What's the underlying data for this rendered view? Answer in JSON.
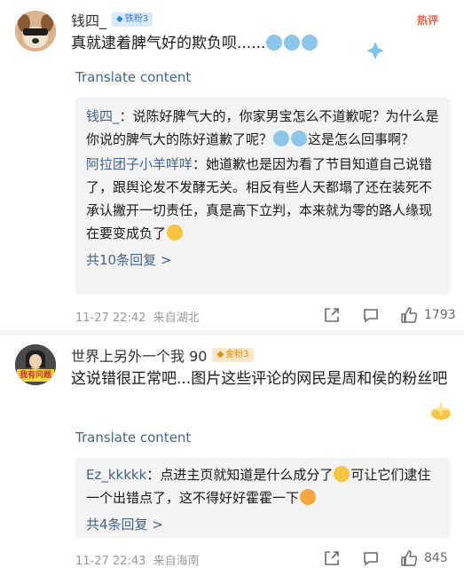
{
  "comments": [
    {
      "username": "钱四_",
      "badge": "铁粉3",
      "hot_label": "热评",
      "text": "真就逮着脾气好的欺负呗......",
      "translate": "Translate content",
      "replies": [
        {
          "name": "钱四_",
          "text": "说陈好脾气大的，你家男宝怎么不道歉呢？为什么是你说的脾气大的陈好道歉了呢？",
          "text_tail": "这是怎么回事啊？"
        },
        {
          "name": "阿拉团子小羊咩咩",
          "text": "她道歉也是因为看了节目知道自己说错了，跟舆论发不发酵无关。相反有些人天都塌了还在装死不承认撇开一切责任，真是高下立判，本来就为零的路人缘现在要变成负了"
        }
      ],
      "more": "共10条回复 >",
      "time": "11-27 22:42",
      "location": "来自湖北",
      "likes": "1793"
    },
    {
      "username": "世界上另外一个我 90",
      "badge": "金粉3",
      "avatar_text": "我有问题",
      "text": "这说错很正常吧...图片这些评论的网民是周和侯的粉丝吧",
      "translate": "Translate content",
      "replies": [
        {
          "name": "Ez_kkkkk",
          "text": "点进主页就知道是什么成分了",
          "text_tail": "可让它们逮住一个出错点了，这不得好好霍霍一下"
        }
      ],
      "more": "共4条回复 >",
      "time": "11-27 22:43",
      "location": "来自海南",
      "likes": "845"
    }
  ],
  "colors": {
    "link": "#46628a",
    "hot": "#ff5a3c",
    "reply_bg": "#f3f3f3"
  }
}
